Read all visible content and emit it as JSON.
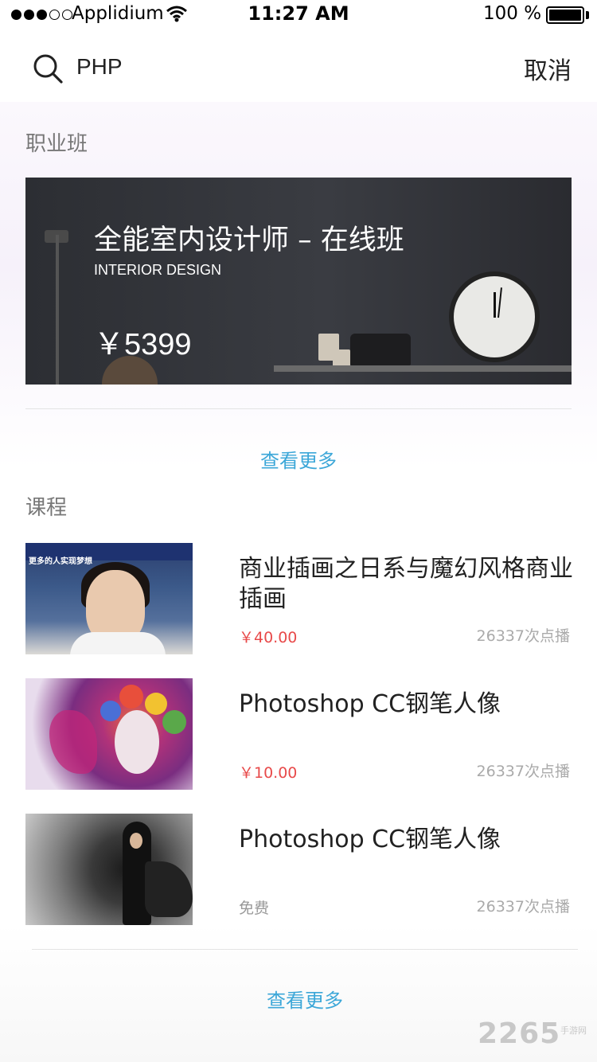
{
  "status_bar": {
    "carrier": "Applidium",
    "time": "11:27 AM",
    "battery": "100 %"
  },
  "search": {
    "value": "PHP",
    "cancel_label": "取消"
  },
  "career_section": {
    "title": "职业班",
    "banner": {
      "title": "全能室内设计师 – 在线班",
      "subtitle": "INTERIOR DESIGN",
      "price": "￥5399"
    },
    "more_label": "查看更多"
  },
  "course_section": {
    "title": "课程",
    "items": [
      {
        "title": "商业插画之日系与魔幻风格商业插画",
        "price": "￥40.00",
        "plays": "26337次点播",
        "thumb_text": "更多的人实现梦想"
      },
      {
        "title": "Photoshop CC钢笔人像",
        "price": "￥10.00",
        "plays": "26337次点播"
      },
      {
        "title": "Photoshop CC钢笔人像",
        "price": "免费",
        "plays": "26337次点播"
      }
    ],
    "more_label": "查看更多"
  },
  "watermark": {
    "main": "2265",
    "sub": "手游网"
  },
  "colors": {
    "link": "#3ca7d8",
    "price": "#e84a4a",
    "muted": "#aaaaaa"
  },
  "icons": {
    "search": "search-icon",
    "wifi": "wifi-icon",
    "battery": "battery-icon"
  }
}
